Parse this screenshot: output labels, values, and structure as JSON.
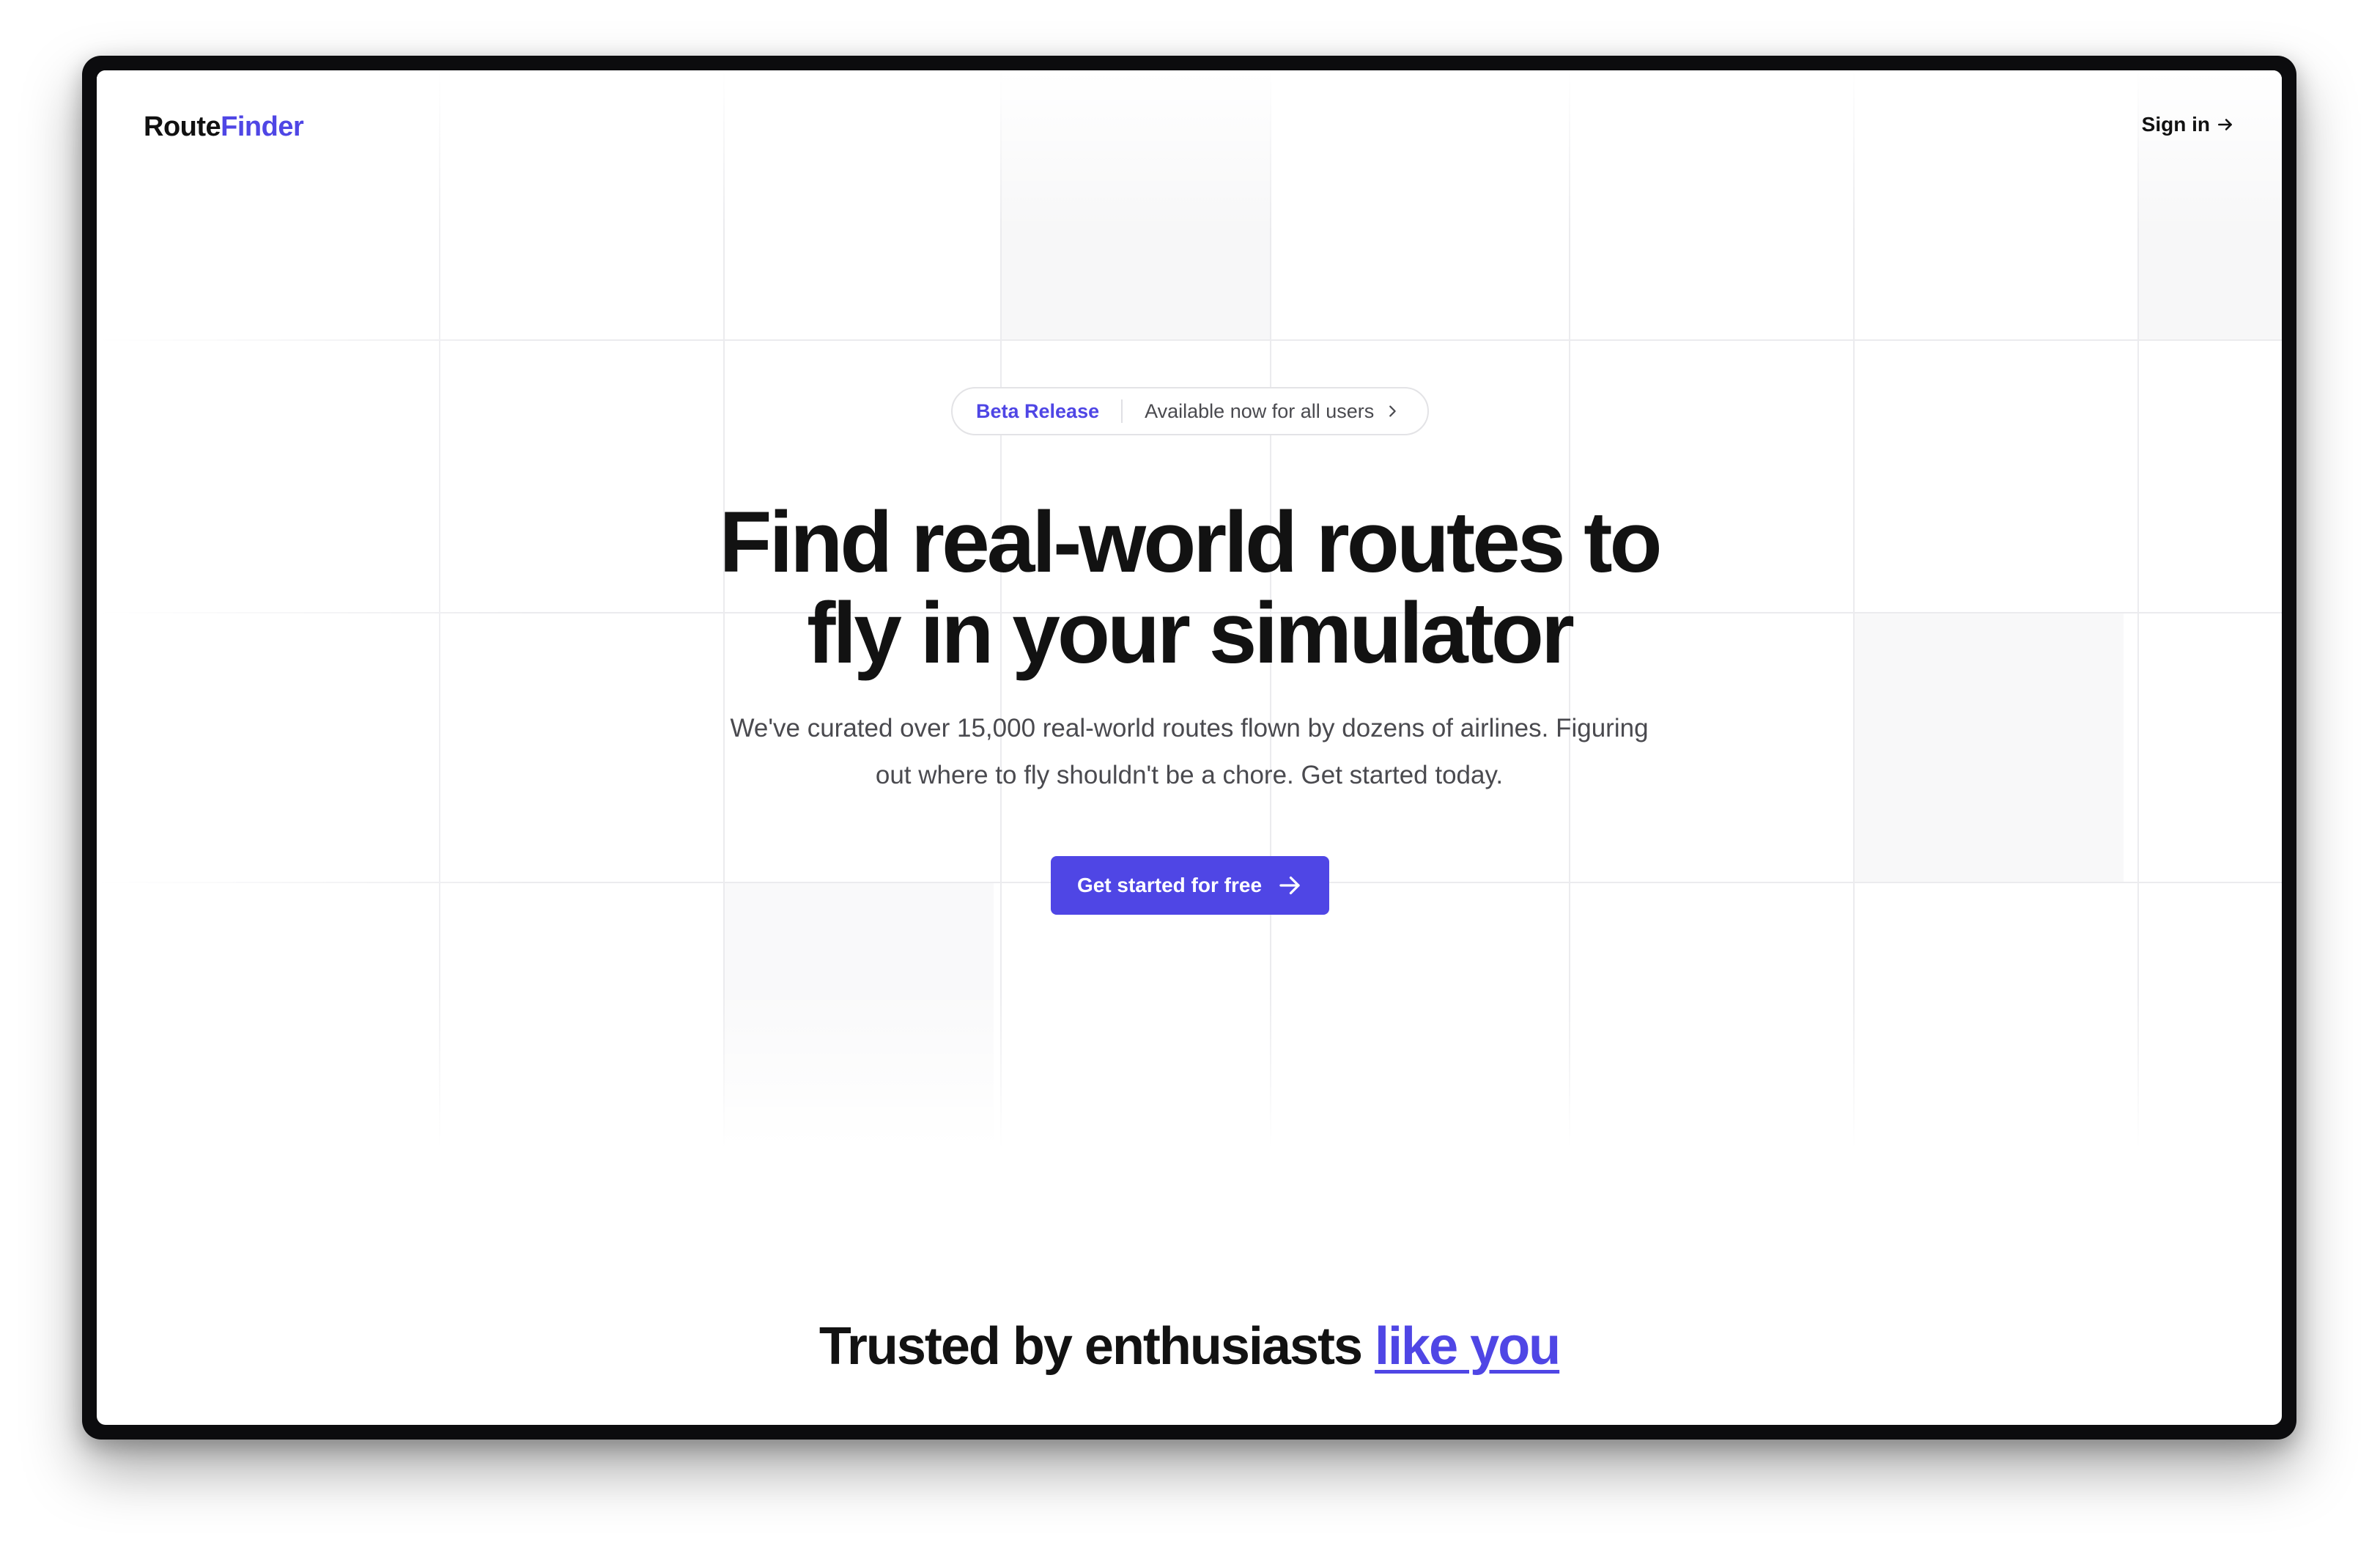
{
  "brand": {
    "name_part1": "Route",
    "name_part2": "Finder",
    "accent_color": "#4f46e5"
  },
  "nav": {
    "signin_label": "Sign in",
    "signin_icon": "arrow-right-icon"
  },
  "announcement": {
    "badge": "Beta Release",
    "text": "Available now for all users",
    "icon": "chevron-right-icon"
  },
  "hero": {
    "headline_line1": "Find real-world routes to",
    "headline_line2": "fly in your simulator",
    "subtext_line1": "We've curated over 15,000 real-world routes flown by dozens of airlines. Figuring",
    "subtext_line2": "out where to fly shouldn't be a chore. Get started today.",
    "cta_label": "Get started for free",
    "cta_icon": "arrow-right-icon"
  },
  "social_proof": {
    "heading": "Trusted by enthusiasts",
    "heading_link": "like you"
  }
}
